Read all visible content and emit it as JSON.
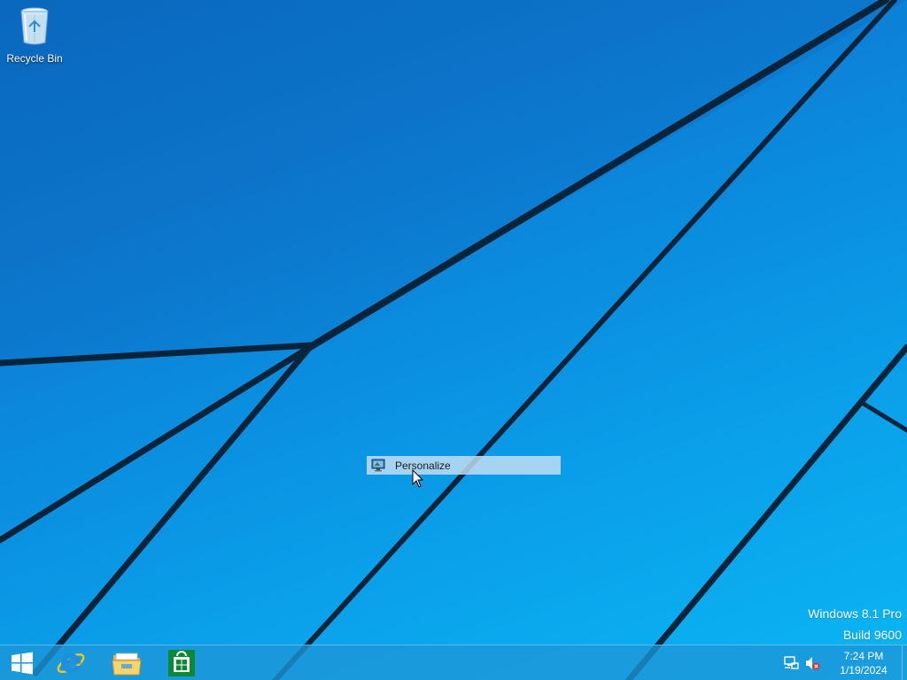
{
  "desktop": {
    "icons": [
      {
        "label": "Recycle Bin",
        "icon": "recycle-bin-icon"
      }
    ]
  },
  "context_menu": {
    "items": [
      {
        "label": "Personalize",
        "icon": "display-settings-icon",
        "highlighted": true
      }
    ]
  },
  "watermark": {
    "line1": "Windows 8.1 Pro",
    "line2": "Build 9600"
  },
  "taskbar": {
    "start_icon": "windows-logo-icon",
    "pinned": [
      {
        "name": "Internet Explorer",
        "icon": "internet-explorer-icon"
      },
      {
        "name": "File Explorer",
        "icon": "file-explorer-icon"
      },
      {
        "name": "Store",
        "icon": "store-icon"
      }
    ],
    "tray": {
      "network_icon": "network-icon",
      "volume_icon": "volume-muted-icon"
    },
    "clock": {
      "time": "7:24 PM",
      "date": "1/19/2024"
    }
  },
  "colors": {
    "desktop_top": "#0a6fc6",
    "desktop_bottom": "#0ab6f4",
    "taskbar": "#1e96d7",
    "store_green": "#0b8a35",
    "ie_blue": "#1e8fe0",
    "folder_yellow": "#f2c94c"
  }
}
